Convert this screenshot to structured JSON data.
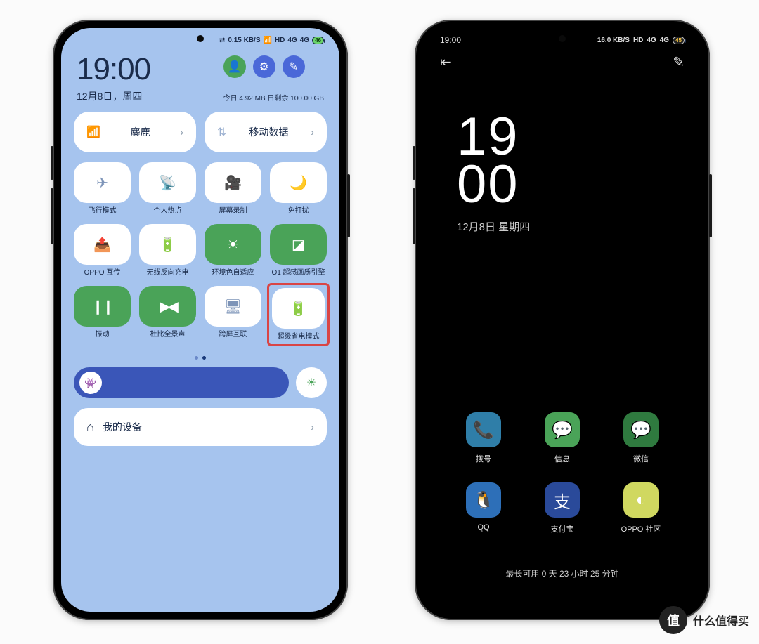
{
  "status": {
    "kbs": "0.15 KB/S",
    "hd": "HD",
    "signal1": "4G",
    "signal2": "4G",
    "battery": "46",
    "bt": "⇄"
  },
  "cc": {
    "time": "19:00",
    "date": "12月8日，周四",
    "usage": "今日 4.92 MB 日剩余 100.00 GB",
    "actions": {
      "user": "●",
      "settings": "⚙",
      "edit": "✎"
    },
    "wifi": {
      "label": "麋鹿"
    },
    "data": {
      "label": "移动数据"
    },
    "tiles": [
      {
        "icon": "i-plane",
        "label": "飞行模式",
        "on": false
      },
      {
        "icon": "i-hotspot",
        "label": "个人热点",
        "on": false
      },
      {
        "icon": "i-rec",
        "label": "屏幕录制",
        "on": false
      },
      {
        "icon": "i-dnd",
        "label": "免打扰",
        "on": false
      },
      {
        "icon": "i-share",
        "label": "OPPO 互传",
        "on": false
      },
      {
        "icon": "i-revchg",
        "label": "无线反向充电",
        "on": false
      },
      {
        "icon": "i-sun",
        "label": "环境色自适应",
        "on": true
      },
      {
        "icon": "i-quality",
        "label": "O1 超感画质引擎",
        "on": true
      },
      {
        "icon": "i-vib",
        "label": "振动",
        "on": true
      },
      {
        "icon": "i-dolby",
        "label": "杜比全景声",
        "on": true
      },
      {
        "icon": "i-cast",
        "label": "跨屏互联",
        "on": false
      },
      {
        "icon": "i-battery",
        "label": "超级省电模式",
        "on": false,
        "highlight": true
      }
    ],
    "brightness_thumb": "👾",
    "device_label": "我的设备"
  },
  "saver": {
    "status": {
      "time": "19:00",
      "kbs": "16.0 KB/S",
      "hd": "HD",
      "sig1": "4G",
      "sig2": "4G",
      "battery": "45"
    },
    "clock_a": "19",
    "clock_b": "00",
    "date": "12月8日 星期四",
    "apps": [
      {
        "name": "拨号",
        "bg": "#2f7ea8",
        "glyph": "📞"
      },
      {
        "name": "信息",
        "bg": "#4aa358",
        "glyph": "💬"
      },
      {
        "name": "微信",
        "bg": "#2f7a3f",
        "glyph": "💬"
      },
      {
        "name": "QQ",
        "bg": "#2d6fb8",
        "glyph": "🐧"
      },
      {
        "name": "支付宝",
        "bg": "#2a4a9a",
        "glyph": "支"
      },
      {
        "name": "OPPO 社区",
        "bg": "#d0d860",
        "glyph": "◐"
      }
    ],
    "note": "最长可用 0 天 23 小时 25 分钟"
  },
  "watermark": {
    "badge": "值",
    "text": "什么值得买"
  }
}
